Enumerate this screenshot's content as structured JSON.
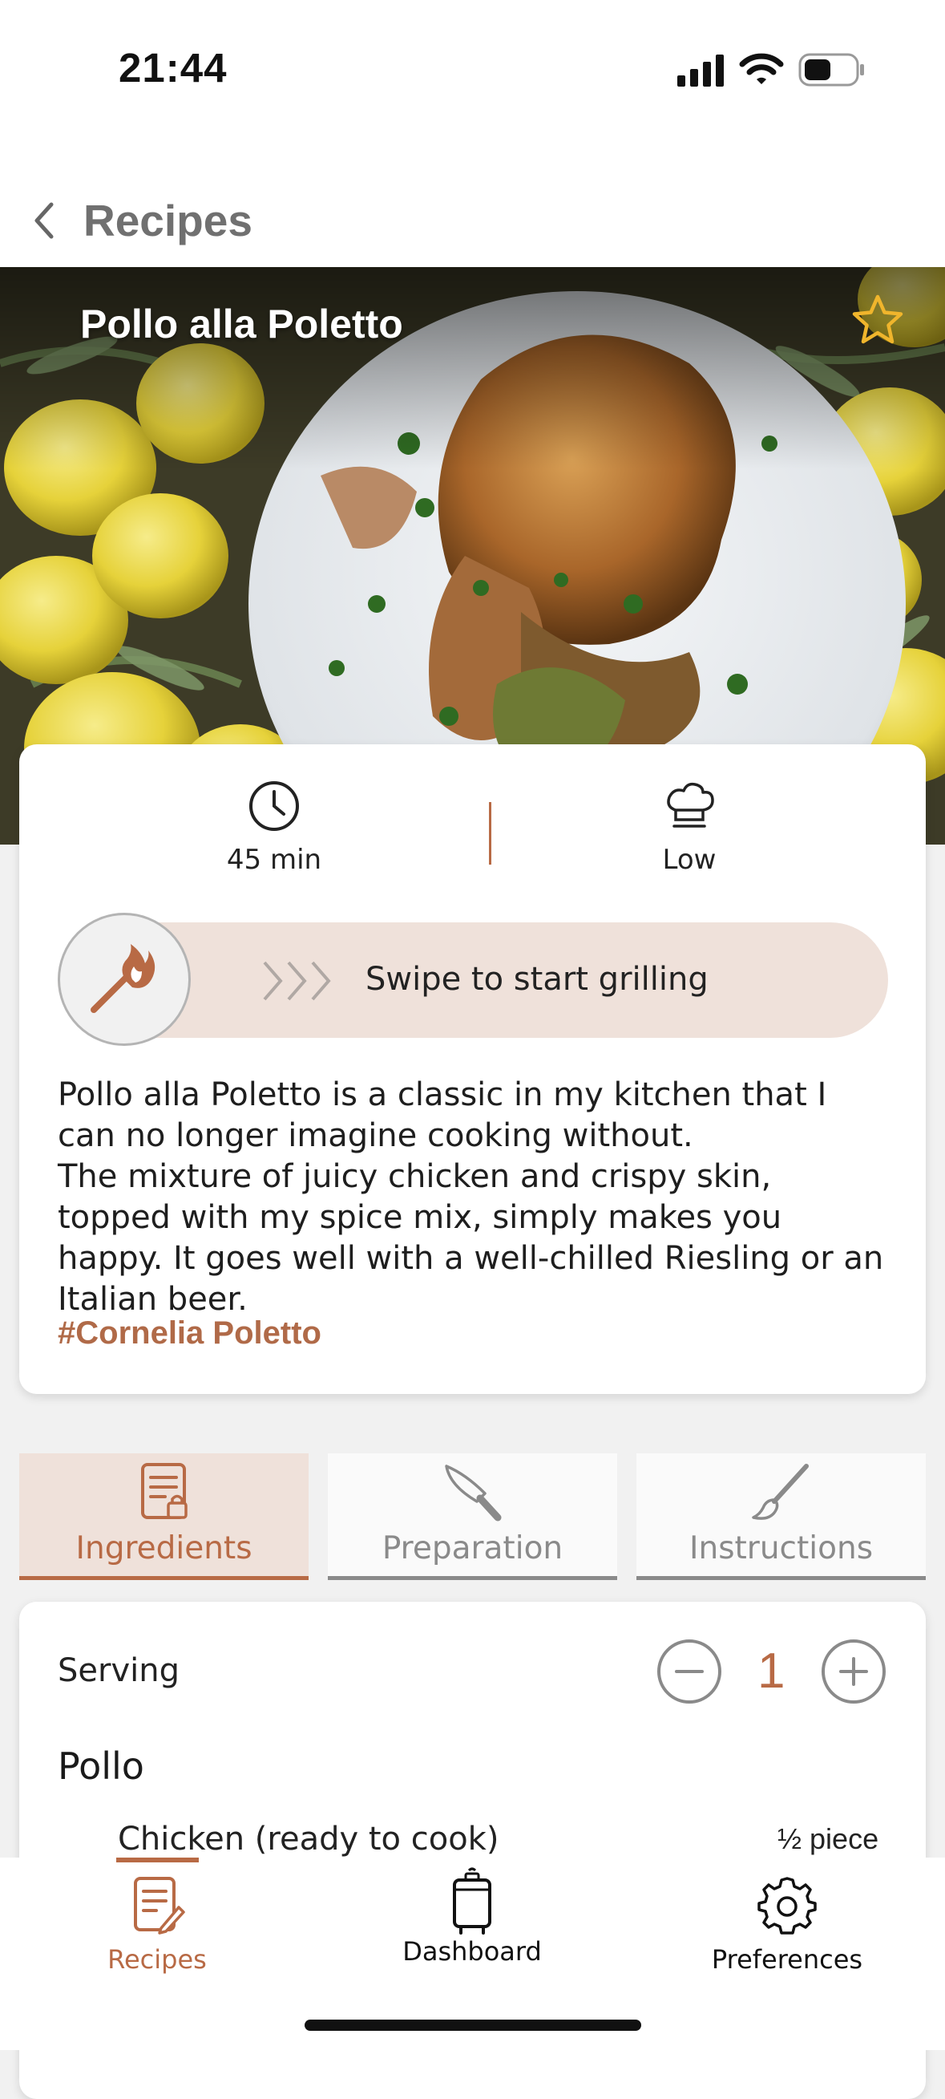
{
  "status_bar": {
    "time": "21:44"
  },
  "nav": {
    "back_label": "Recipes"
  },
  "recipe": {
    "title": "Pollo alla Poletto",
    "favorite": false,
    "duration": "45 min",
    "difficulty": "Low",
    "swipe_text": "Swipe to start grilling",
    "description": "Pollo alla Poletto is a classic in my kitchen that I can no longer imagine cooking without.\nThe mixture of juicy chicken and crispy skin, topped with my spice mix, simply makes you happy. It goes well with a well-chilled Riesling or an Italian beer.",
    "hashtag": "#Cornelia Poletto"
  },
  "tabs": [
    {
      "label": "Ingredients",
      "icon": "recipe-list-icon",
      "active": true
    },
    {
      "label": "Preparation",
      "icon": "knife-icon",
      "active": false
    },
    {
      "label": "Instructions",
      "icon": "brush-icon",
      "active": false
    }
  ],
  "ingredients": {
    "serving_label": "Serving",
    "serving_value": "1",
    "section_title": "Pollo",
    "items": [
      {
        "name": "Chicken (ready to cook)",
        "quantity": "½ piece"
      }
    ]
  },
  "tabbar": [
    {
      "label": "Recipes",
      "icon": "recipes-icon",
      "active": true
    },
    {
      "label": "Dashboard",
      "icon": "grill-icon",
      "active": false
    },
    {
      "label": "Preferences",
      "icon": "gear-icon",
      "active": false
    }
  ],
  "colors": {
    "accent": "#b86a45",
    "accent_light": "#efe1da",
    "inactive": "#8a8a8a",
    "background": "#f1f1f1"
  }
}
